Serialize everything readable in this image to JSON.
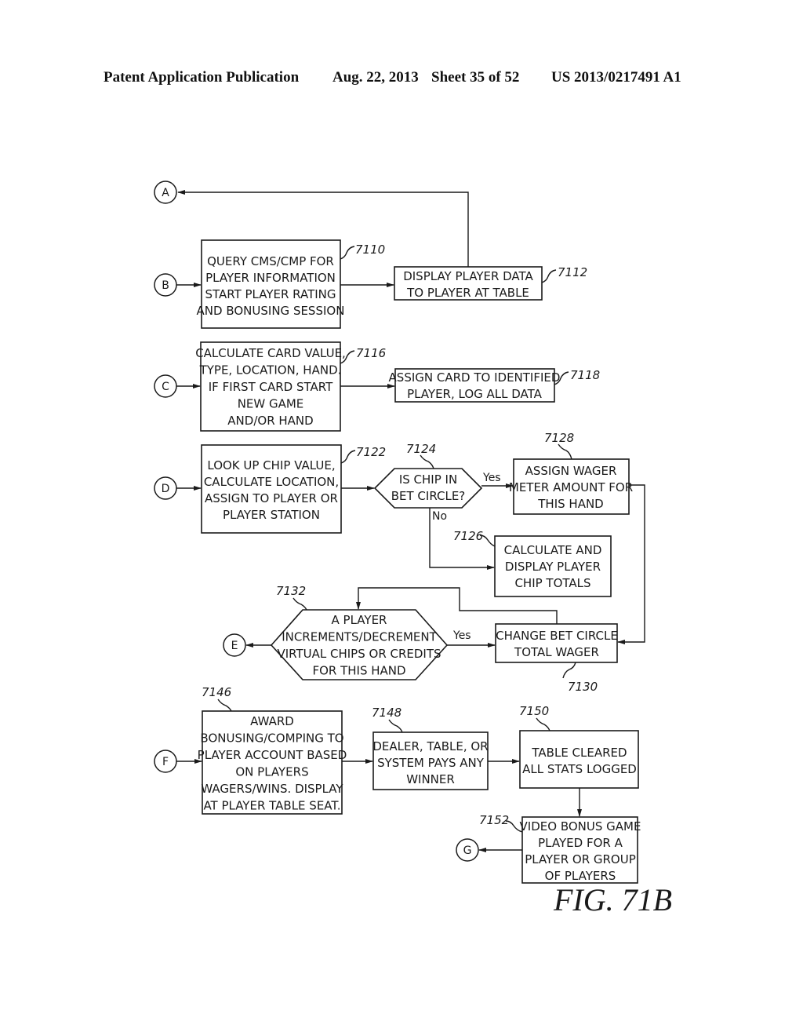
{
  "header": {
    "publication": "Patent Application Publication",
    "date": "Aug. 22, 2013",
    "sheet": "Sheet 35 of 52",
    "number": "US 2013/0217491 A1"
  },
  "figure_label": "FIG. 71B",
  "connectors": {
    "A": "A",
    "B": "B",
    "C": "C",
    "D": "D",
    "E": "E",
    "F": "F",
    "G": "G"
  },
  "nodes": {
    "n7110": {
      "ref": "7110",
      "lines": [
        "QUERY CMS/CMP FOR",
        "PLAYER INFORMATION",
        "START PLAYER RATING",
        "AND BONUSING SESSION"
      ]
    },
    "n7112": {
      "ref": "7112",
      "lines": [
        "DISPLAY PLAYER DATA",
        "TO PLAYER AT TABLE"
      ]
    },
    "n7116": {
      "ref": "7116",
      "lines": [
        "CALCULATE CARD VALUE,",
        "TYPE, LOCATION, HAND.",
        "IF FIRST CARD START",
        "NEW GAME",
        "AND/OR HAND"
      ]
    },
    "n7118": {
      "ref": "7118",
      "lines": [
        "ASSIGN CARD TO IDENTIFIED",
        "PLAYER, LOG ALL DATA"
      ]
    },
    "n7122": {
      "ref": "7122",
      "lines": [
        "LOOK UP CHIP VALUE,",
        "CALCULATE LOCATION,",
        "ASSIGN TO PLAYER OR",
        "PLAYER STATION"
      ]
    },
    "n7124": {
      "ref": "7124",
      "lines": [
        "IS CHIP IN",
        "BET CIRCLE?"
      ]
    },
    "n7126": {
      "ref": "7126",
      "lines": [
        "CALCULATE AND",
        "DISPLAY PLAYER",
        "CHIP TOTALS"
      ]
    },
    "n7128": {
      "ref": "7128",
      "lines": [
        "ASSIGN WAGER",
        "METER AMOUNT FOR",
        "THIS HAND"
      ]
    },
    "n7130": {
      "ref": "7130",
      "lines": [
        "CHANGE BET CIRCLE",
        "TOTAL WAGER"
      ]
    },
    "n7132": {
      "ref": "7132",
      "lines": [
        "A PLAYER",
        "INCREMENTS/DECREMENT",
        "VIRTUAL CHIPS OR CREDITS",
        "FOR THIS HAND"
      ]
    },
    "n7146": {
      "ref": "7146",
      "lines": [
        "AWARD",
        "BONUSING/COMPING TO",
        "PLAYER ACCOUNT BASED",
        "ON PLAYERS",
        "WAGERS/WINS. DISPLAY",
        "AT PLAYER TABLE SEAT."
      ]
    },
    "n7148": {
      "ref": "7148",
      "lines": [
        "DEALER, TABLE, OR",
        "SYSTEM PAYS ANY",
        "WINNER"
      ]
    },
    "n7150": {
      "ref": "7150",
      "lines": [
        "TABLE CLEARED",
        "ALL STATS LOGGED"
      ]
    },
    "n7152": {
      "ref": "7152",
      "lines": [
        "VIDEO BONUS GAME",
        "PLAYED FOR A",
        "PLAYER OR GROUP",
        "OF PLAYERS"
      ]
    }
  },
  "edge_labels": {
    "yes_7124": "Yes",
    "no_7124": "No",
    "yes_7132": "Yes"
  }
}
